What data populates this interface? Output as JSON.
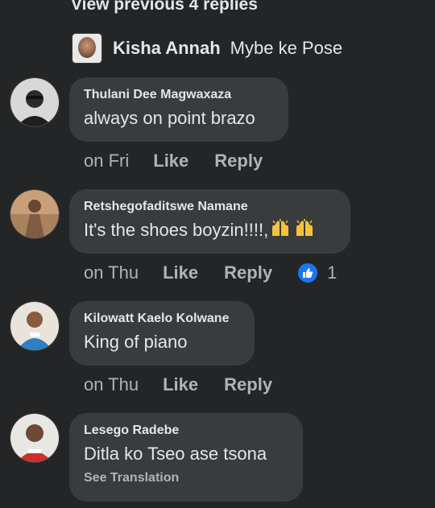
{
  "thread": {
    "view_previous": "View previous 4 replies",
    "top_reply": {
      "name": "Kisha Annah",
      "text": "Mybe ke Pose"
    }
  },
  "comments": [
    {
      "name": "Thulani Dee Magwaxaza",
      "text": "always on point brazo",
      "time": "on Fri",
      "like": "Like",
      "reply": "Reply"
    },
    {
      "name": "Retshegofaditswe Namane",
      "text": "It's the shoes boyzin!!!!,",
      "time": "on Thu",
      "like": "Like",
      "reply": "Reply",
      "reaction_count": "1",
      "emoji": "raised-hands-emoji x2"
    },
    {
      "name": "Kilowatt Kaelo Kolwane",
      "text": "King of piano",
      "time": "on Thu",
      "like": "Like",
      "reply": "Reply"
    },
    {
      "name": "Lesego Radebe",
      "text": "Ditla ko Tseo ase tsona",
      "see_translation": "See Translation"
    }
  ],
  "colors": {
    "background": "#242526",
    "bubble": "#3a3b3c",
    "text_primary": "#e4e6eb",
    "text_secondary": "#b0b3b8",
    "like_blue": "#1877f2"
  }
}
